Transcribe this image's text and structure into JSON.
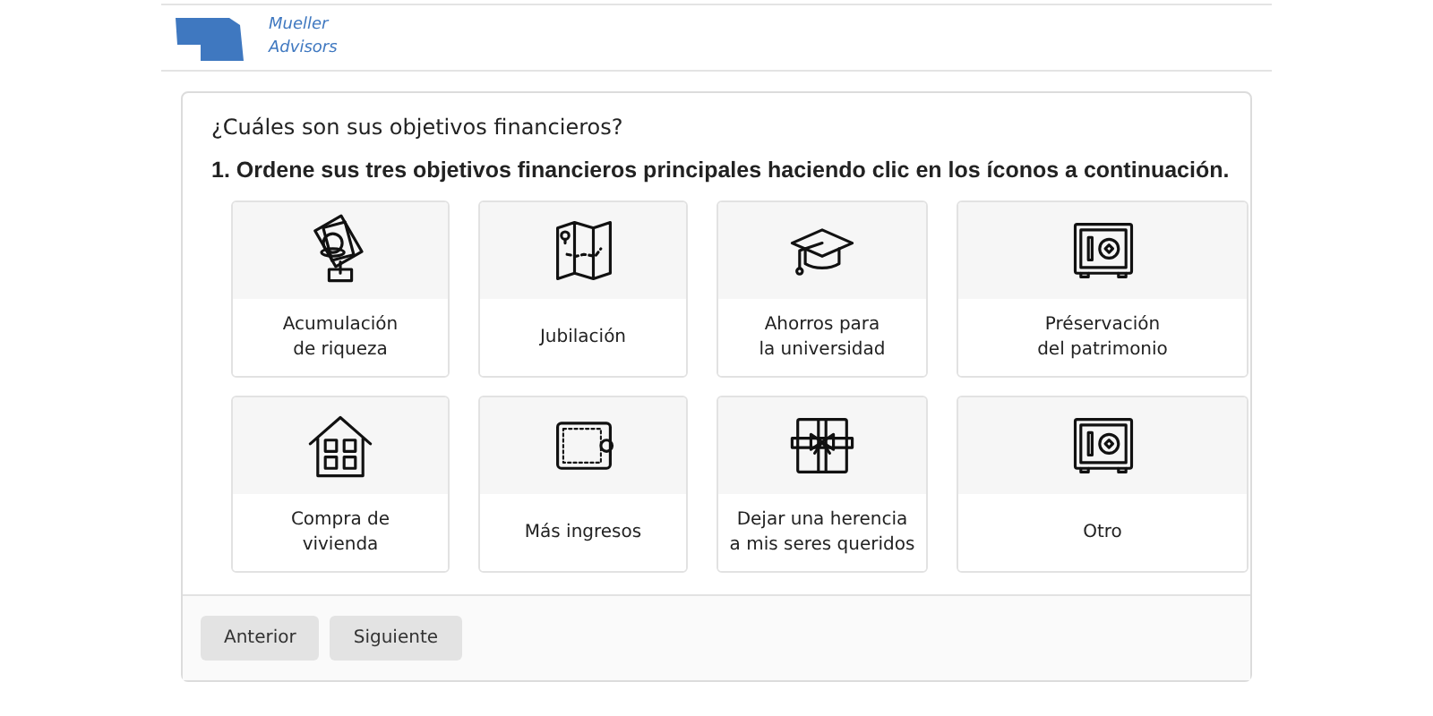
{
  "header": {
    "logo_lines": [
      "Mueller",
      "Advisors"
    ]
  },
  "question": "¿Cuáles son sus objetivos financieros?",
  "instruction": "1. Ordene sus tres objetivos financieros principales haciendo clic en los íconos a continuación.",
  "options": [
    {
      "kind": "money",
      "lines": [
        "Acumulación",
        "de riqueza"
      ]
    },
    {
      "kind": "map",
      "lines": [
        "Jubilación"
      ]
    },
    {
      "kind": "cap",
      "lines": [
        "Ahorros para",
        "la universidad"
      ]
    },
    {
      "kind": "safe",
      "lines": [
        "Préservación",
        "del patrimonio"
      ]
    },
    {
      "kind": "house",
      "lines": [
        "Compra de",
        "vivienda"
      ]
    },
    {
      "kind": "wallet",
      "lines": [
        "Más ingresos"
      ]
    },
    {
      "kind": "gift",
      "lines": [
        "Dejar una herencia",
        "a mis seres queridos"
      ]
    },
    {
      "kind": "safe",
      "lines": [
        "Otro"
      ]
    }
  ],
  "buttons": [
    "Anterior",
    "Siguiente"
  ]
}
